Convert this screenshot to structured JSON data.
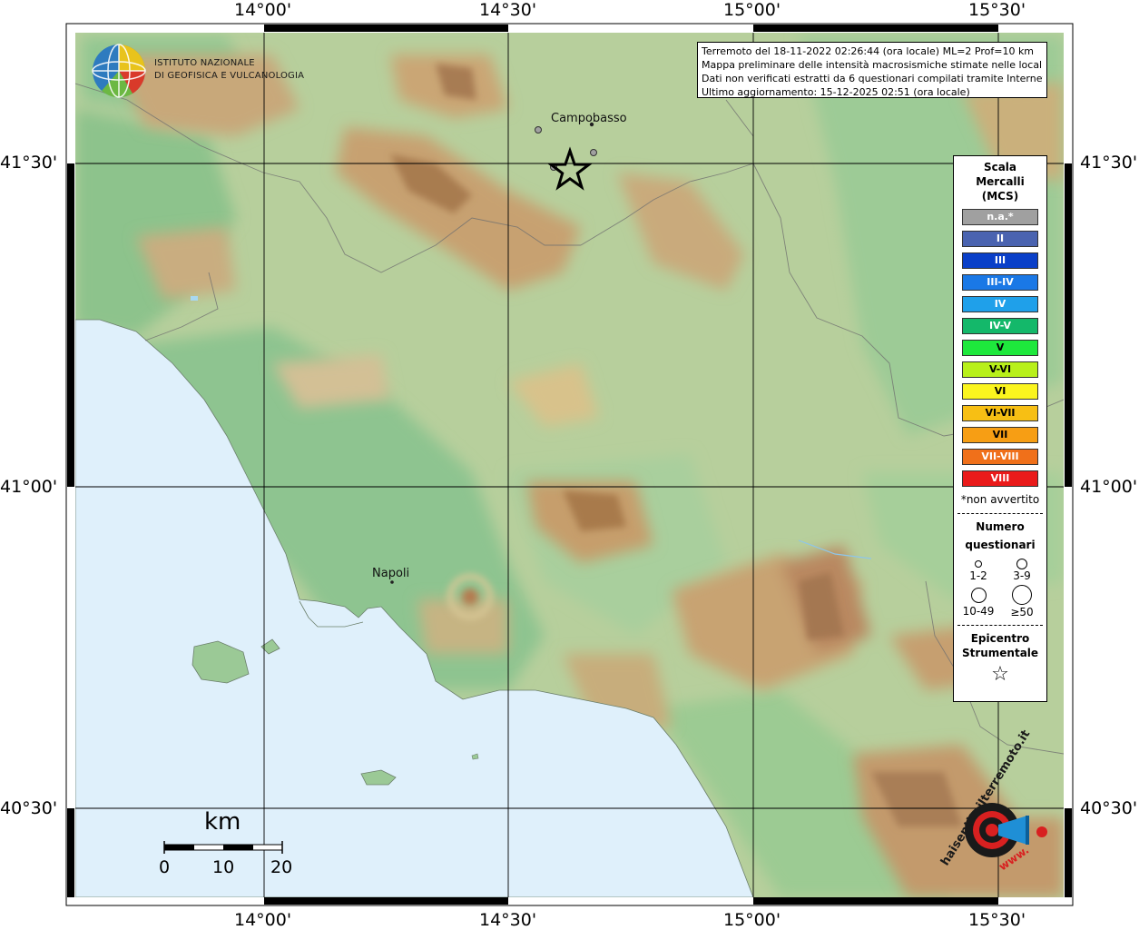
{
  "map": {
    "coord_labels": {
      "top": [
        "14°00'",
        "14°30'",
        "15°00'",
        "15°30'"
      ],
      "bottom": [
        "14°00'",
        "14°30'",
        "15°00'",
        "15°30'"
      ],
      "left": [
        "41°30'",
        "41°00'",
        "40°30'"
      ],
      "right": [
        "41°30'",
        "41°00'",
        "40°30'"
      ]
    },
    "places": [
      {
        "name": "Campobasso"
      },
      {
        "name": "Napoli"
      }
    ],
    "colors": {
      "sea": "#dff0fb",
      "lowland": "#8fc48f",
      "hill": "#b6d0a0",
      "mountain": "#c9a574",
      "peak": "#a57c55"
    }
  },
  "logo": {
    "line1": "ISTITUTO NAZIONALE",
    "line2": "DI GEOFISICA E VULCANOLOGIA"
  },
  "info": {
    "line1": "Terremoto del 18-11-2022 02:26:44 (ora locale) ML=2 Prof=10 km",
    "line2": "Mappa preliminare delle intensità macrosismiche stimate nelle località",
    "line3": "Dati non verificati estratti da 6 questionari compilati tramite Internet.",
    "line4": "Ultimo aggiornamento: 15-12-2025 02:51 (ora locale)"
  },
  "legend": {
    "title_lines": [
      "Scala",
      "Mercalli",
      "(MCS)"
    ],
    "intensities": [
      {
        "label": "n.a.*",
        "color": "#a0a0a0"
      },
      {
        "label": "II",
        "color": "#4a63b0"
      },
      {
        "label": "III",
        "color": "#0a3fc8"
      },
      {
        "label": "III-IV",
        "color": "#1a78e6"
      },
      {
        "label": "IV",
        "color": "#1fa0ea"
      },
      {
        "label": "IV-V",
        "color": "#14b86a"
      },
      {
        "label": "V",
        "color": "#1ee83c"
      },
      {
        "label": "V-VI",
        "color": "#b8f01a"
      },
      {
        "label": "VI",
        "color": "#fbf51e"
      },
      {
        "label": "VI-VII",
        "color": "#f7bf14"
      },
      {
        "label": "VII",
        "color": "#f79e14"
      },
      {
        "label": "VII-VIII",
        "color": "#f0701a"
      },
      {
        "label": "VIII",
        "color": "#ea1a1a"
      }
    ],
    "note": "*non avvertito",
    "count_title_lines": [
      "Numero",
      "questionari"
    ],
    "count_classes": [
      "1-2",
      "3-9",
      "10-49",
      "≥50"
    ],
    "epicenter_title_lines": [
      "Epicentro",
      "Strumentale"
    ],
    "epicenter_icon": "star-outline-icon"
  },
  "scale_bar": {
    "unit": "km",
    "ticks": [
      "0",
      "10",
      "20"
    ]
  },
  "badge": {
    "text": "haisentitoilterremoto.it",
    "www": "www.",
    "icon": "megaphone-target-icon"
  }
}
